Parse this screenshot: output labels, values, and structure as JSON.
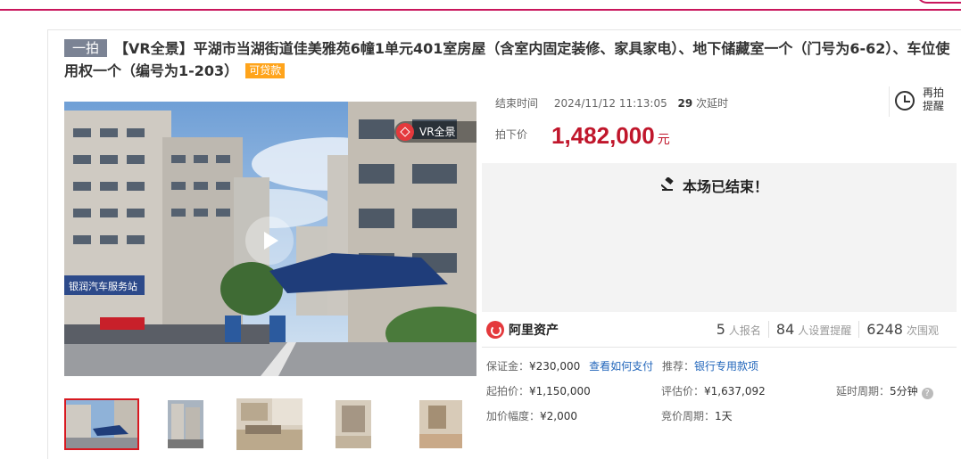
{
  "header": {
    "tag": "一拍",
    "title": "【VR全景】平湖市当湖街道佳美雅苑6幢1单元401室房屋（含室内固定装修、家具家电）、地下储藏室一个（门号为6-62）、车位使用权一个（编号为1-203）",
    "loan_badge": "可贷款"
  },
  "gallery": {
    "vr_badge": "VR全景",
    "thumbnail_count": 5
  },
  "auction": {
    "end_label": "结束时间",
    "end_time": "2024/11/12 11:13:05",
    "extensions_count": "29",
    "extensions_label": "次延时",
    "remind_label": "再拍提醒",
    "price_label": "拍下价",
    "price": "1,482,000",
    "price_unit": "元",
    "status": "本场已结束！"
  },
  "platform": {
    "name": "阿里资产",
    "signups": "5",
    "signups_label": "人报名",
    "reminders": "84",
    "reminders_label": "人设置提醒",
    "views": "6248",
    "views_label": "次围观"
  },
  "details": {
    "deposit_label": "保证金：",
    "deposit": "¥230,000",
    "how_to_pay": "查看如何支付",
    "recommend_label": "推荐：",
    "recommend_link": "银行专用款项",
    "start_price_label": "起拍价：",
    "start_price": "¥1,150,000",
    "appraisal_label": "评估价：",
    "appraisal": "¥1,637,092",
    "delay_label": "延时周期：",
    "delay": "5分钟",
    "increment_label": "加价幅度：",
    "increment": "¥2,000",
    "cycle_label": "竞价周期：",
    "cycle": "1天"
  },
  "colors": {
    "accent": "#c0162b",
    "brand": "#c9165c",
    "link": "#2266bb",
    "loan_badge": "#ffa41b"
  }
}
